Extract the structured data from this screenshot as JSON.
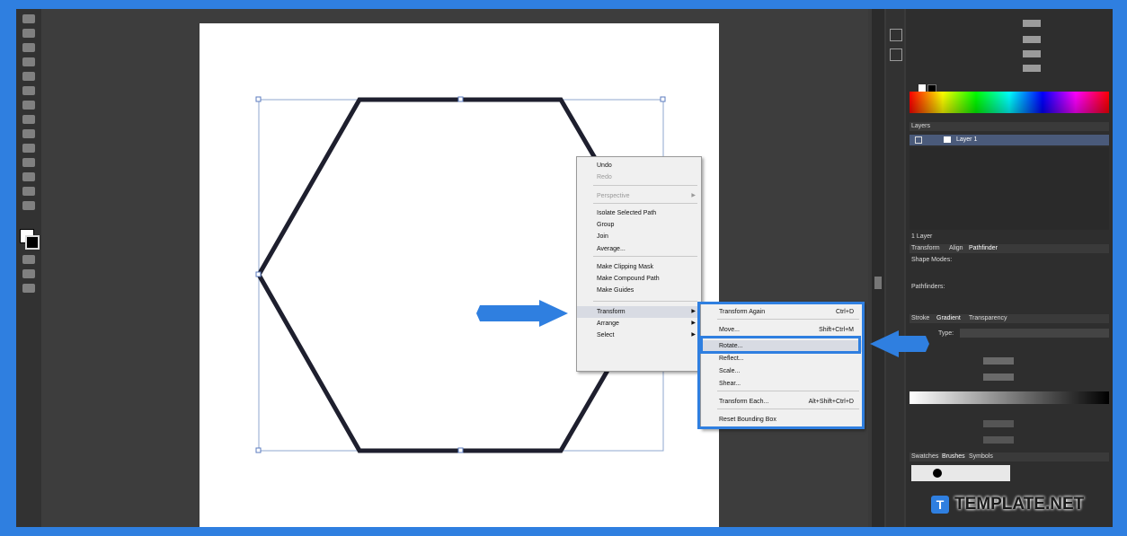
{
  "context_menu": {
    "items": [
      {
        "label": "Undo",
        "disabled": false
      },
      {
        "label": "Redo",
        "disabled": true
      },
      {
        "label": "Perspective",
        "disabled": true,
        "submenu": true
      },
      {
        "label": "Isolate Selected Path",
        "disabled": false
      },
      {
        "label": "Group",
        "disabled": false
      },
      {
        "label": "Join",
        "disabled": false
      },
      {
        "label": "Average...",
        "disabled": false
      },
      {
        "label": "Make Clipping Mask",
        "disabled": false
      },
      {
        "label": "Make Compound Path",
        "disabled": false
      },
      {
        "label": "Make Guides",
        "disabled": false
      },
      {
        "label": "Transform",
        "disabled": false,
        "submenu": true
      },
      {
        "label": "Arrange",
        "disabled": false,
        "submenu": true
      },
      {
        "label": "Select",
        "disabled": false,
        "submenu": true
      }
    ]
  },
  "transform_menu": {
    "items": [
      {
        "label": "Transform Again",
        "shortcut": "Ctrl+D"
      },
      {
        "label": "Move...",
        "shortcut": "Shift+Ctrl+M"
      },
      {
        "label": "Rotate...",
        "shortcut": ""
      },
      {
        "label": "Reflect...",
        "shortcut": ""
      },
      {
        "label": "Scale...",
        "shortcut": ""
      },
      {
        "label": "Shear...",
        "shortcut": ""
      },
      {
        "label": "Transform Each...",
        "shortcut": "Alt+Shift+Ctrl+D"
      },
      {
        "label": "Reset Bounding Box",
        "shortcut": ""
      }
    ]
  },
  "panels": {
    "layers_tab": "Layers",
    "layer_name": "Layer 1",
    "layers_count": "1 Layer",
    "transform_tabs": [
      "Transform",
      "Align",
      "Pathfinder"
    ],
    "shape_modes": "Shape Modes:",
    "pathfinders": "Pathfinders:",
    "stroke_tabs": [
      "Stroke",
      "Gradient",
      "Transparency"
    ],
    "gradient_type_label": "Type:",
    "bottom_tabs": [
      "Swatches",
      "Brushes",
      "Symbols"
    ]
  },
  "watermark": {
    "brand": "TEMPLATE.NET"
  },
  "colors": {
    "highlight": "#2f7fe0",
    "hexagon_stroke": "#1e1f2e"
  }
}
